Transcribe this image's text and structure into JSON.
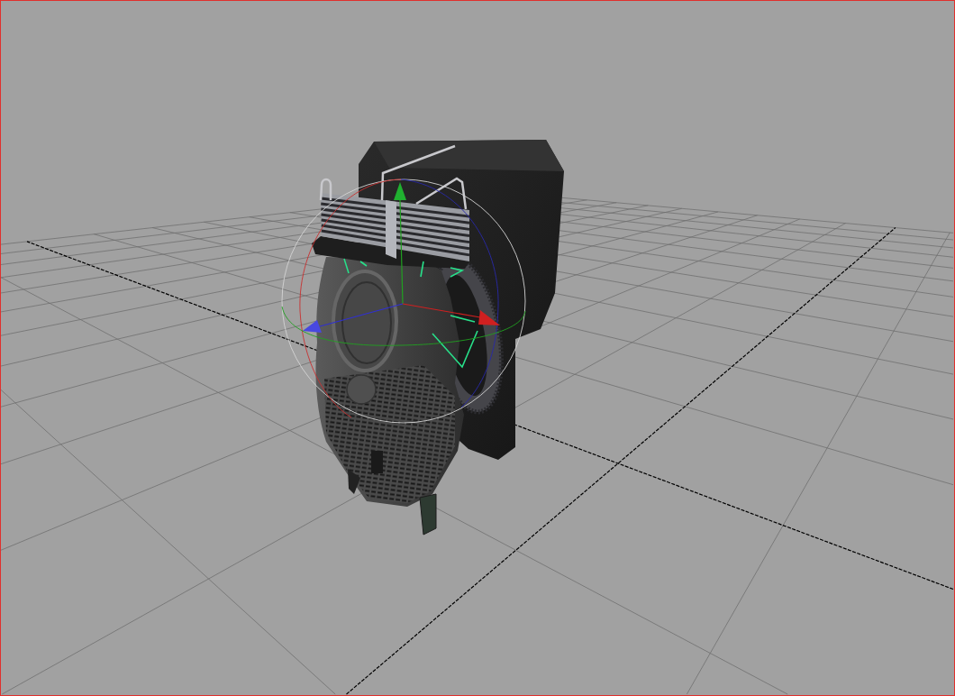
{
  "viewport": {
    "active": true
  },
  "model": {
    "selected": true
  },
  "manipulator": {
    "kind": "rotate"
  }
}
